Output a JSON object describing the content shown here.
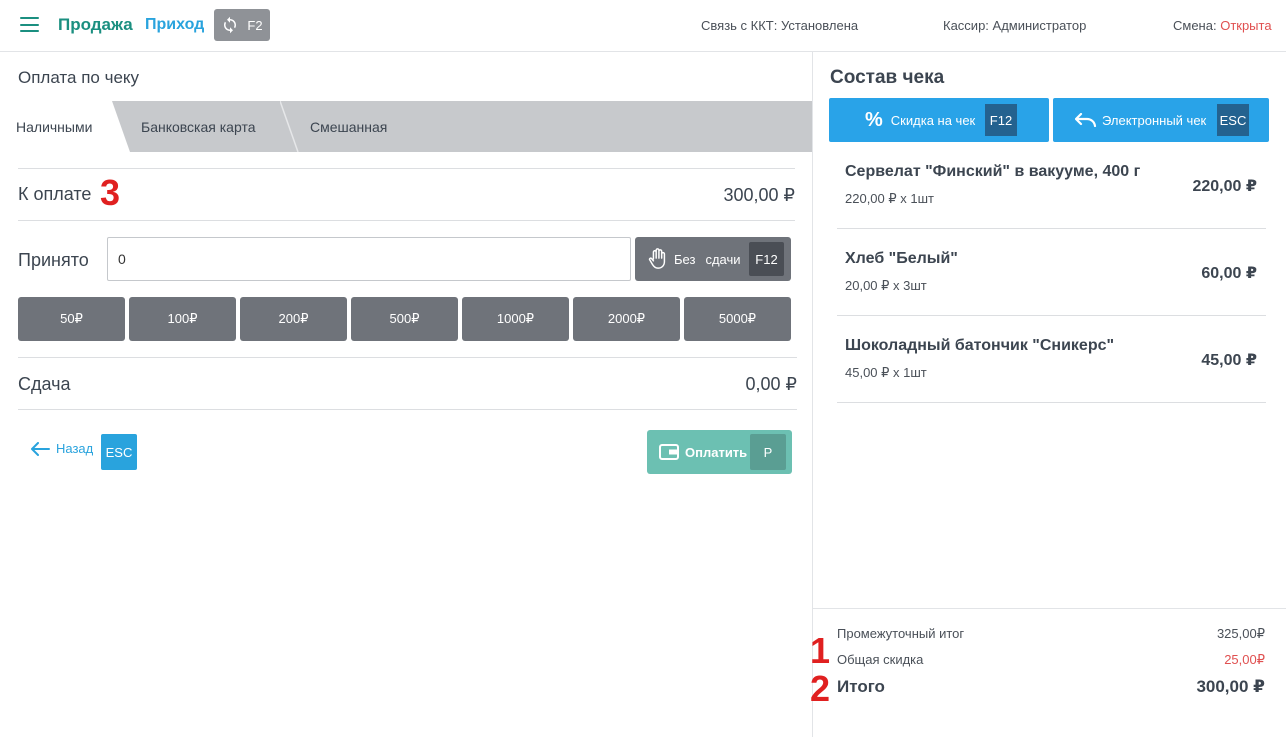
{
  "header": {
    "nav_sale": "Продажа",
    "nav_income": "Приход",
    "sync_key": "F2",
    "kkt_status": "Связь с ККТ: Установлена",
    "cashier": "Кассир: Администратор",
    "shift_label": "Смена:",
    "shift_value": "Открыта"
  },
  "payment": {
    "title": "Оплата по чеку",
    "tabs": [
      {
        "label": "Наличными",
        "active": true
      },
      {
        "label": "Банковская карта",
        "active": false
      },
      {
        "label": "Смешанная",
        "active": false
      }
    ],
    "to_pay_label": "К оплате",
    "to_pay_marker": "3",
    "to_pay_value": "300,00 ₽",
    "accepted_label": "Принято",
    "accepted_value": "0",
    "no_change_label1": "Без",
    "no_change_label2": "сдачи",
    "no_change_key": "F12",
    "bills": [
      "50₽",
      "100₽",
      "200₽",
      "500₽",
      "1000₽",
      "2000₽",
      "5000₽"
    ],
    "change_label": "Сдача",
    "change_value": "0,00 ₽",
    "back_label": "Назад",
    "back_key": "ESC",
    "pay_label": "Оплатить",
    "pay_key": "P"
  },
  "receipt": {
    "title": "Состав чека",
    "discount_button": "Скидка на чек",
    "discount_key": "F12",
    "ereceipt_button": "Электронный чек",
    "ereceipt_key": "ESC",
    "items": [
      {
        "name": "Сервелат \"Финский\" в вакууме, 400 г",
        "sub": "220,00 ₽ x 1шт",
        "price": "220,00 ₽"
      },
      {
        "name": "Хлеб \"Белый\"",
        "sub": "20,00 ₽ x 3шт",
        "price": "60,00 ₽"
      },
      {
        "name": "Шоколадный батончик \"Сникерс\"",
        "sub": "45,00 ₽ x 1шт",
        "price": "45,00 ₽"
      }
    ],
    "subtotal_label": "Промежуточный итог",
    "subtotal_value": "325,00₽",
    "discount_label": "Общая скидка",
    "discount_value": "25,00₽",
    "total_label": "Итого",
    "total_value": "300,00 ₽",
    "marker_1": "1",
    "marker_2": "2"
  },
  "colors": {
    "accent_green": "#1b8f80",
    "accent_blue": "#29a3dd",
    "danger_red": "#e05050",
    "marker_red": "#e02020"
  }
}
